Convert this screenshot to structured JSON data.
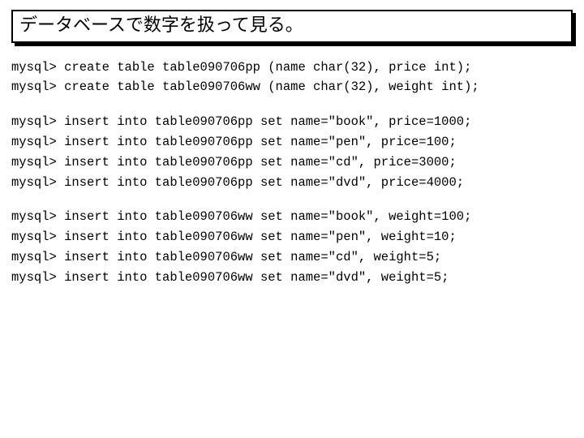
{
  "title": "データベースで数字を扱って見る。",
  "blocks": {
    "create": [
      "mysql> create table table090706pp (name char(32), price int);",
      "mysql> create table table090706ww (name char(32), weight int);"
    ],
    "insert_pp": [
      "mysql> insert into table090706pp set name=\"book\", price=1000;",
      "mysql> insert into table090706pp set name=\"pen\", price=100;",
      "mysql> insert into table090706pp set name=\"cd\", price=3000;",
      "mysql> insert into table090706pp set name=\"dvd\", price=4000;"
    ],
    "insert_ww": [
      "mysql> insert into table090706ww set name=\"book\", weight=100;",
      "mysql> insert into table090706ww set name=\"pen\", weight=10;",
      "mysql> insert into table090706ww set name=\"cd\", weight=5;",
      "mysql> insert into table090706ww set name=\"dvd\", weight=5;"
    ]
  }
}
